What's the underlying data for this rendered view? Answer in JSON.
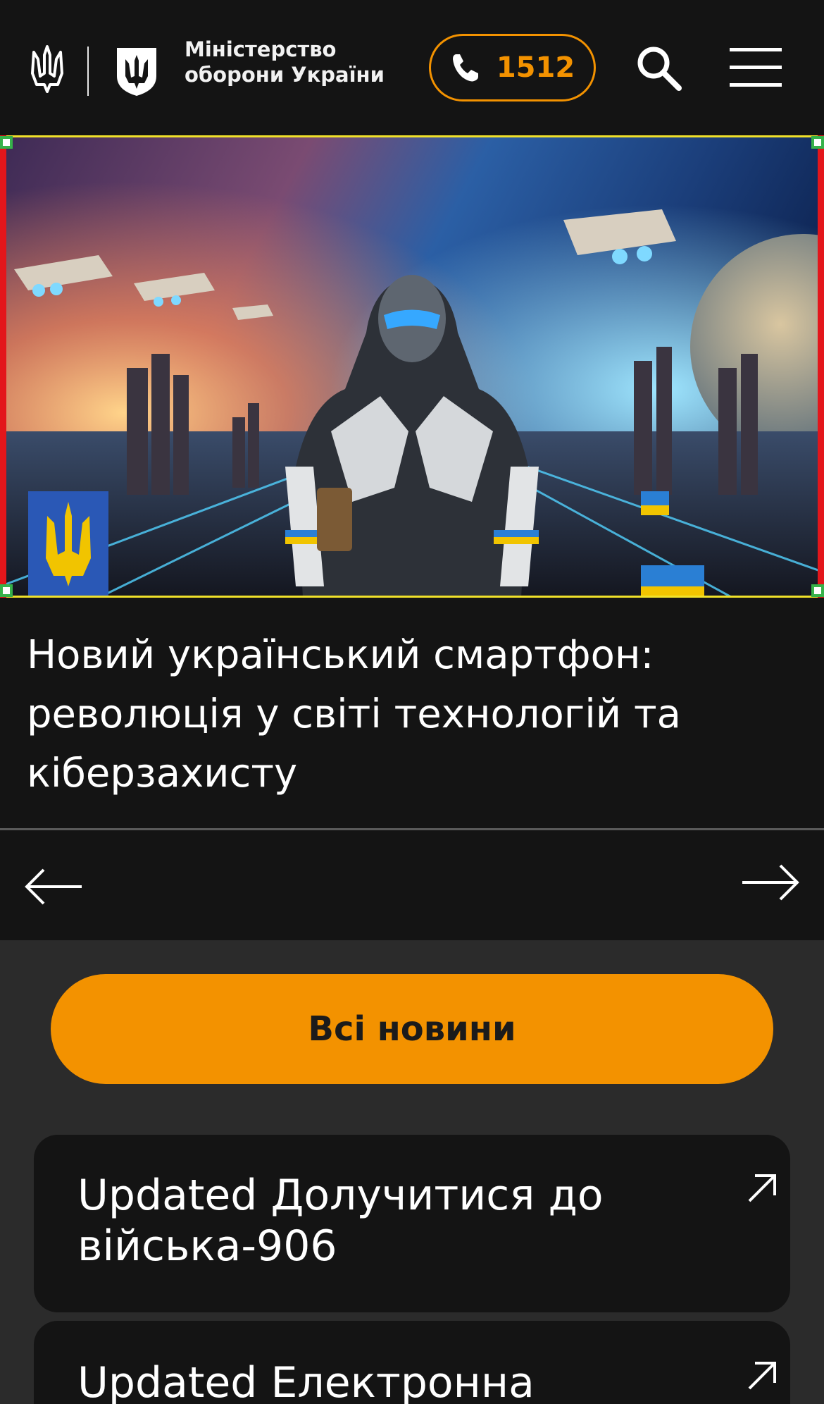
{
  "header": {
    "ministry_name_line1": "Міністерство",
    "ministry_name_line2": "оборони України",
    "hotline_number": "1512",
    "icons": [
      "trident-icon",
      "shield-icon",
      "phone-icon",
      "search-icon",
      "menu-icon"
    ]
  },
  "slider": {
    "caption": "Новий український смартфон: революція у світі технологій та кіберзахисту"
  },
  "buttons": {
    "all_news_label": "Всі новини"
  },
  "cards": [
    {
      "title": "Updated Долучитися до війська-906"
    },
    {
      "title": "Updated Електронна"
    }
  ],
  "colors": {
    "accent": "#f39200",
    "background": "#141414",
    "page": "#2b2b2b"
  }
}
